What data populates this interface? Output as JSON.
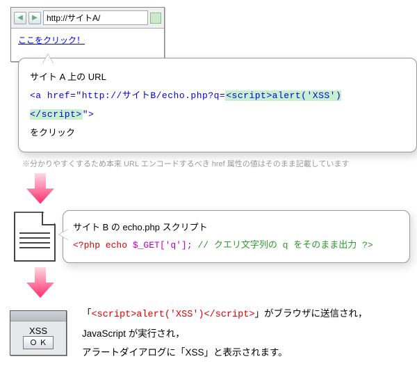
{
  "browser": {
    "url": "http://サイトA/",
    "link_text": "ここをクリック！"
  },
  "bubble1": {
    "line1": "サイト A 上の URL",
    "code_prefix": "<a href=\"http://サイトB/echo.php?q=",
    "code_script": "<script>alert('XSS')</script>",
    "code_suffix": "\">",
    "line3": "をクリック"
  },
  "note": "※分かりやすくするため本来 URL エンコードするべき href 属性の値はそのまま記載しています",
  "bubble2": {
    "line1": "サイト B の echo.php スクリプト",
    "php_open": "<?php echo ",
    "php_var": "$_GET['q'];",
    "php_comment": " // クエリ文字列の q をそのまま出力 ?>"
  },
  "alert": {
    "message": "XSS",
    "ok": "Ｏ Ｋ"
  },
  "final": {
    "l1a": "「",
    "l1b": "<script>alert('XSS')</script>",
    "l1c": "」がブラウザに送信され，",
    "l2": "JavaScript が実行され，",
    "l3": "アラートダイアログに「XSS」と表示されます。"
  }
}
